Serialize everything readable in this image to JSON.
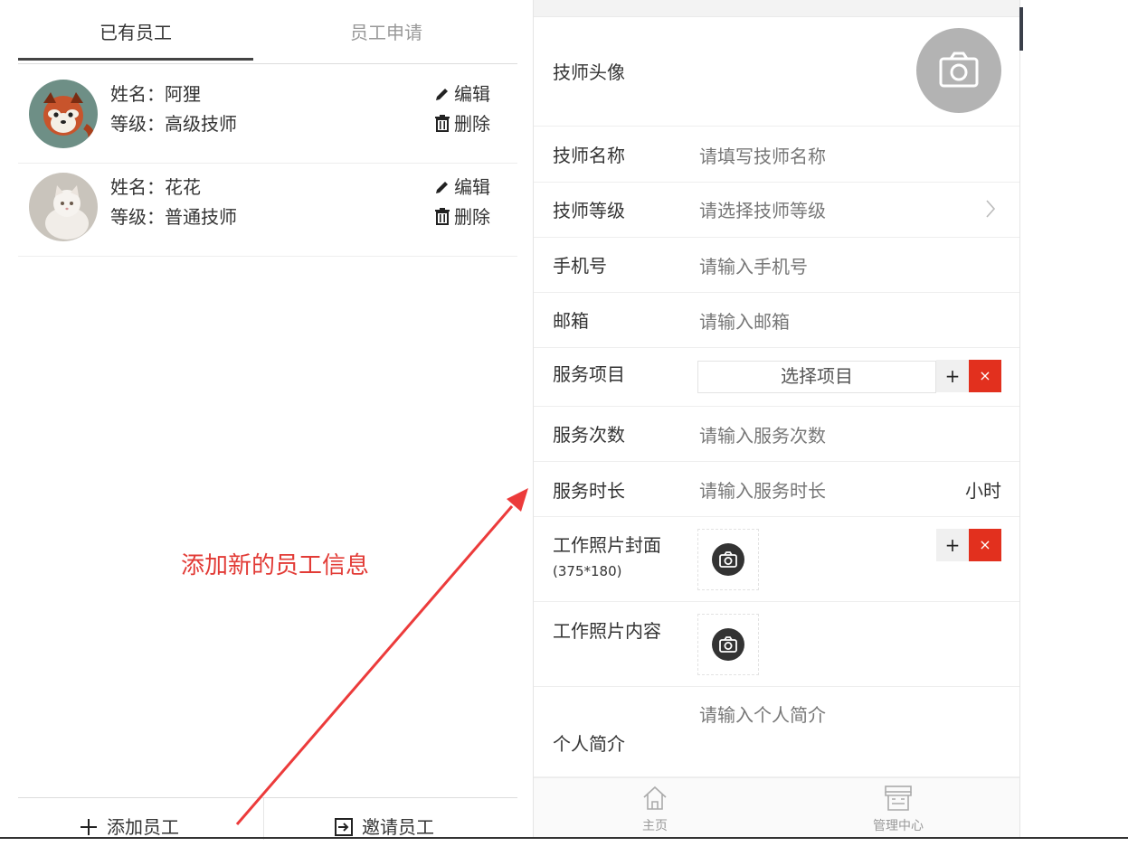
{
  "left": {
    "tabs": [
      {
        "label": "已有员工",
        "active": true
      },
      {
        "label": "员工申请",
        "active": false
      }
    ],
    "employees": [
      {
        "name_line": "姓名：阿狸",
        "level_line": "等级：高级技师",
        "edit": "编辑",
        "delete": "删除",
        "avatar": "red-panda-avatar"
      },
      {
        "name_line": "姓名：花花",
        "level_line": "等级：普通技师",
        "edit": "编辑",
        "delete": "删除",
        "avatar": "cat-avatar"
      }
    ],
    "bottom": {
      "add": "添加员工",
      "invite": "邀请员工"
    }
  },
  "annotation": {
    "text": "添加新的员工信息",
    "color": "#e23b36"
  },
  "form": {
    "avatar_label": "技师头像",
    "fields": {
      "name": {
        "label": "技师名称",
        "placeholder": "请填写技师名称"
      },
      "level": {
        "label": "技师等级",
        "placeholder": "请选择技师等级"
      },
      "phone": {
        "label": "手机号",
        "placeholder": "请输入手机号"
      },
      "email": {
        "label": "邮箱",
        "placeholder": "请输入邮箱"
      },
      "service_item": {
        "label": "服务项目",
        "select": "选择项目",
        "plus": "+",
        "remove": "×"
      },
      "service_count": {
        "label": "服务次数",
        "placeholder": "请输入服务次数"
      },
      "service_duration": {
        "label": "服务时长",
        "placeholder": "请输入服务时长",
        "unit": "小时"
      },
      "photo_cover": {
        "label": "工作照片封面",
        "note": "(375*180)",
        "plus": "+",
        "remove": "×"
      },
      "photo_content": {
        "label": "工作照片内容"
      },
      "bio": {
        "label": "个人简介",
        "placeholder": "请输入个人简介"
      }
    }
  },
  "tabbar": {
    "home": "主页",
    "manage": "管理中心"
  },
  "colors": {
    "danger": "#e2301e",
    "avatar_placeholder": "#b3b3b3",
    "muted": "#999999"
  }
}
